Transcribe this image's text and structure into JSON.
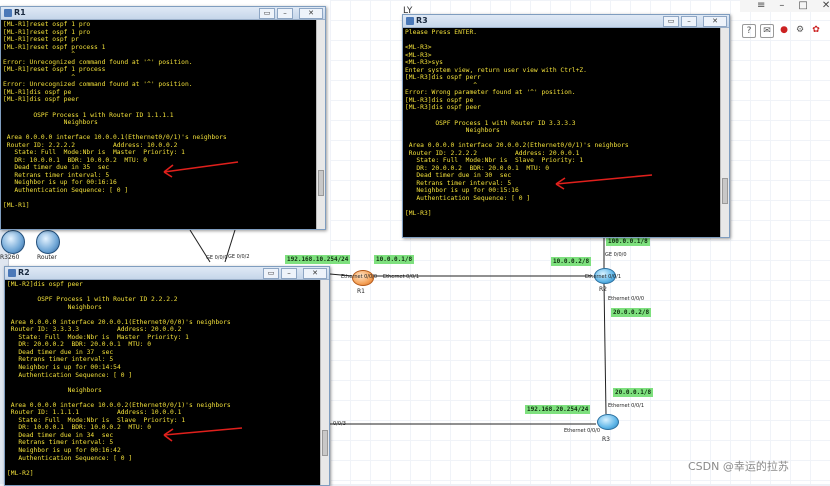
{
  "app": {
    "ly_label": "LY",
    "watermark": "CSDN @幸运的拉苏"
  },
  "palette": {
    "items": [
      {
        "label": "R3260"
      },
      {
        "label": "Router"
      }
    ]
  },
  "windows": {
    "r1": {
      "title": "R1",
      "lines": "[ML-R1]reset ospf 1 pro\n[ML-R1]reset ospf 1 pro\n[ML-R1]reset ospf pr\n[ML-R1]reset ospf process 1\n                  ^\nError: Unrecognized command found at '^' position.\n[ML-R1]reset ospf 1 process\n                  ^\nError: Unrecognized command found at '^' position.\n[ML-R1]dis ospf pe\n[ML-R1]dis ospf peer\n\n        OSPF Process 1 with Router ID 1.1.1.1\n                Neighbors\n\n Area 0.0.0.0 interface 10.0.0.1(Ethernet0/0/1)'s neighbors\n Router ID: 2.2.2.2          Address: 10.0.0.2\n   State: Full  Mode:Nbr is  Master  Priority: 1\n   DR: 10.0.0.1  BDR: 10.0.0.2  MTU: 0\n   Dead timer due in 35  sec\n   Retrans timer interval: 5\n   Neighbor is up for 00:16:16\n   Authentication Sequence: [ 0 ]\n\n[ML-R1]"
    },
    "r2": {
      "title": "R2",
      "lines": "[ML-R2]dis ospf peer\n\n        OSPF Process 1 with Router ID 2.2.2.2\n                Neighbors\n\n Area 0.0.0.0 interface 20.0.0.1(Ethernet0/0/0)'s neighbors\n Router ID: 3.3.3.3          Address: 20.0.0.2\n   State: Full  Mode:Nbr is  Master  Priority: 1\n   DR: 20.0.0.2  BDR: 20.0.0.1  MTU: 0\n   Dead timer due in 37  sec\n   Retrans timer interval: 5\n   Neighbor is up for 00:14:54\n   Authentication Sequence: [ 0 ]\n\n                Neighbors\n\n Area 0.0.0.0 interface 10.0.0.2(Ethernet0/0/1)'s neighbors\n Router ID: 1.1.1.1          Address: 10.0.0.1\n   State: Full  Mode:Nbr is  Slave  Priority: 1\n   DR: 10.0.0.1  BDR: 10.0.0.2  MTU: 0\n   Dead timer due in 34  sec\n   Retrans timer interval: 5\n   Neighbor is up for 00:16:42\n   Authentication Sequence: [ 0 ]\n\n[ML-R2]"
    },
    "r3": {
      "title": "R3",
      "lines": "Please Press ENTER.\n\n<ML-R3>\n<ML-R3>\n<ML-R3>sys\nEnter system view, return user view with Ctrl+Z.\n[ML-R3]dis ospf perr\n                  ^\nError: Wrong parameter found at '^' position.\n[ML-R3]dis ospf pe\n[ML-R3]dis ospf peer\n\n        OSPF Process 1 with Router ID 3.3.3.3\n                Neighbors\n\n Area 0.0.0.0 interface 20.0.0.2(Ethernet0/0/1)'s neighbors\n Router ID: 2.2.2.2          Address: 20.0.0.1\n   State: Full  Mode:Nbr is  Slave  Priority: 1\n   DR: 20.0.0.2  BDR: 20.0.0.1  MTU: 0\n   Dead timer due in 30  sec\n   Retrans timer interval: 5\n   Neighbor is up for 00:15:16\n   Authentication Sequence: [ 0 ]\n\n[ML-R3]"
    }
  },
  "topology": {
    "routers": [
      {
        "name": "R1",
        "color": "#f5a35a"
      },
      {
        "name": "R2",
        "color": "#5fb6e8"
      },
      {
        "name": "R3",
        "color": "#5fb6e8"
      }
    ],
    "net_labels": {
      "n1": "192.168.10.254/24",
      "n2": "10.0.0.1/8",
      "n3": "10.0.0.2/8",
      "n4": "100.0.0.1/8",
      "n5": "20.0.0.2/8",
      "n6": "20.0.0.1/8",
      "n7": "192.168.20.254/24"
    },
    "if_labels": {
      "ge1": "GE 0/0/0",
      "ge2": "GE 0/0/2",
      "r1e0": "Ethernet 0/0/0",
      "r1e1": "Ethernet 0/0/1",
      "r2e1": "Ethernet 0/0/1",
      "r2ge": "GE 0/0/0",
      "r2e0": "Ethernet 0/0/0",
      "r3e1": "Ethernet 0/0/1",
      "r3e0": "Ethernet 0/0/0",
      "left": "0/0/3"
    }
  }
}
